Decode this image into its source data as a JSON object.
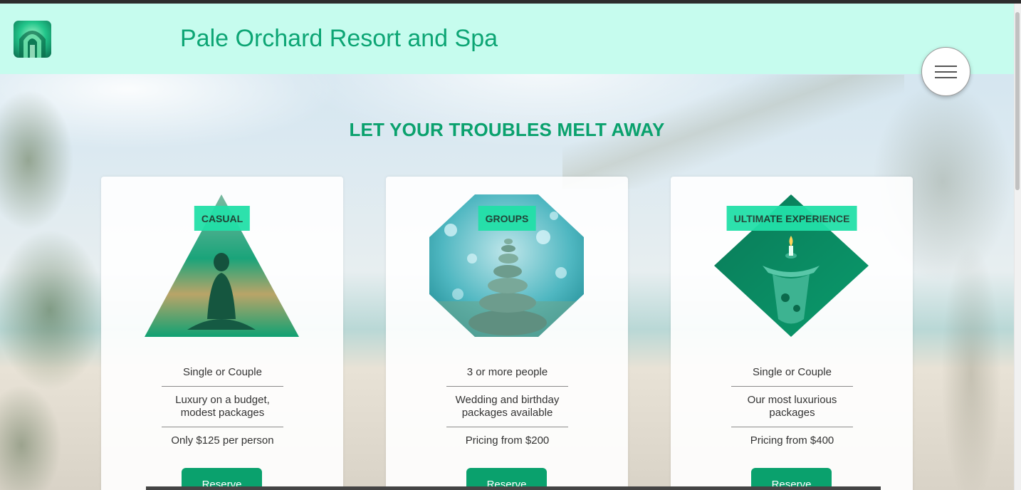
{
  "header": {
    "title": "Pale Orchard Resort and Spa",
    "logo_icon": "resort-logo-icon",
    "menu_icon": "hamburger-menu-icon"
  },
  "main": {
    "headline": "LET YOUR TROUBLES MELT AWAY",
    "cards": [
      {
        "tag": "CASUAL",
        "image": "meditation-yoga-image",
        "shape": "triangle",
        "features": [
          "Single or Couple",
          "Luxury on a budget, modest packages",
          "Only $125 per person"
        ],
        "button": "Reserve"
      },
      {
        "tag": "GROUPS",
        "image": "stacked-stones-image",
        "shape": "octagon",
        "features": [
          "3 or more people",
          "Wedding and birthday packages available",
          "Pricing from $200"
        ],
        "button": "Reserve"
      },
      {
        "tag": "ULTIMATE EXPERIENCE",
        "image": "aroma-candle-image",
        "shape": "diamond",
        "features": [
          "Single or Couple",
          "Our most luxurious packages",
          "Pricing from $400"
        ],
        "button": "Reserve"
      }
    ]
  },
  "colors": {
    "header_bg": "#c6fcee",
    "accent_green": "#0aa16d",
    "tag_green": "#22e0a8"
  }
}
